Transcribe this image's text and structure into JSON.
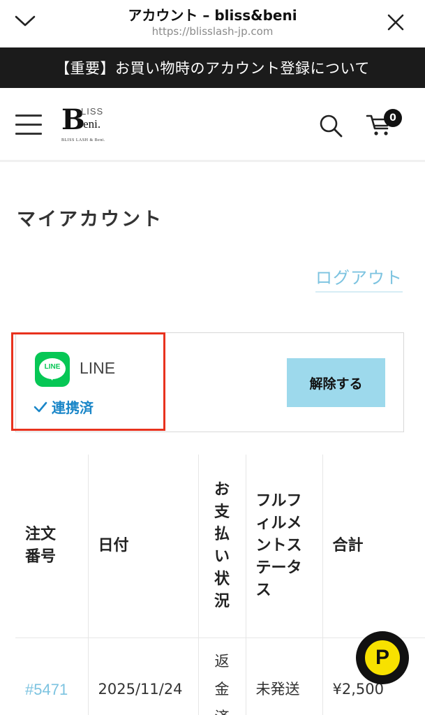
{
  "browser": {
    "title": "アカウント – bliss&beni",
    "url": "https://blisslash-jp.com"
  },
  "announcement": {
    "text": "【重要】お買い物時のアカウント登録について"
  },
  "header": {
    "logo": {
      "letter": "B",
      "top": "LISS",
      "bottom": "'eni.",
      "sub": "BLISS LASH & Beni."
    },
    "cart_count": "0"
  },
  "main": {
    "title": "マイアカウント",
    "logout_label": "ログアウト"
  },
  "line_link": {
    "logo_text": "LINE",
    "name": "LINE",
    "status": "連携済",
    "unlink_label": "解除する",
    "brand_color": "#06c755",
    "highlight_color": "#e8321e"
  },
  "orders": {
    "headers": {
      "order_no": "注文番号",
      "date": "日付",
      "payment_status": "お支払い状況",
      "fulfillment_status": "フルフィルメントステータス",
      "total": "合計"
    },
    "rows": [
      {
        "order_no": "#5471",
        "date": "2025/11/24",
        "payment_status": "返金済",
        "fulfillment_status": "未発送",
        "total": "¥2,500"
      }
    ]
  },
  "floating": {
    "points_label": "P"
  }
}
